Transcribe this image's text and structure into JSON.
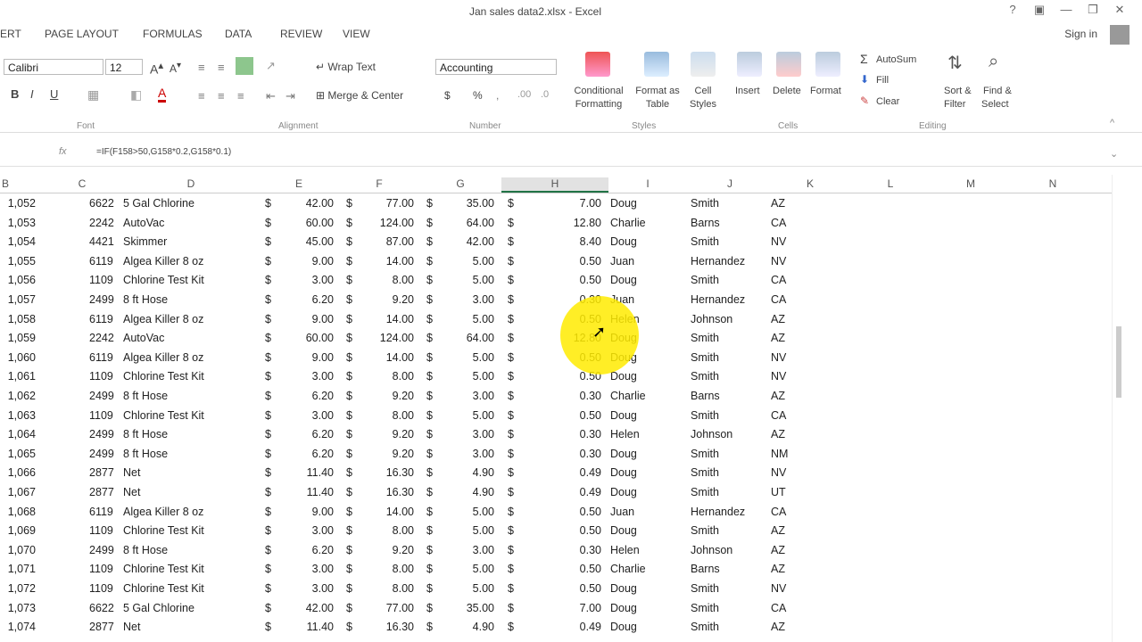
{
  "window": {
    "title": "Jan sales data2.xlsx - Excel",
    "controls": [
      "?",
      "▣",
      "—",
      "❐",
      "✕"
    ]
  },
  "tabs": [
    "ERT",
    "PAGE LAYOUT",
    "FORMULAS",
    "DATA",
    "REVIEW",
    "VIEW"
  ],
  "signin": "Sign in",
  "ribbon": {
    "font_name": "Calibri",
    "font_size": "12",
    "font_group": "Font",
    "alignment_group": "Alignment",
    "number_group": "Number",
    "styles_group": "Styles",
    "cells_group": "Cells",
    "editing_group": "Editing",
    "wrap_text": "Wrap Text",
    "merge_center": "Merge & Center",
    "number_format": "Accounting",
    "bold": "B",
    "italic": "I",
    "underline": "U",
    "currency": "$",
    "percent": "%",
    "conditional": "Conditional",
    "formatting": "Formatting",
    "format_as": "Format as",
    "table": "Table",
    "cell": "Cell",
    "styles": "Styles",
    "insert": "Insert",
    "delete": "Delete",
    "format": "Format",
    "autosum": "AutoSum",
    "fill": "Fill",
    "clear": "Clear",
    "sort": "Sort &",
    "filter": "Filter",
    "find": "Find &",
    "select": "Select"
  },
  "formula": "=IF(F158>50,G158*0.2,G158*0.1)",
  "columns": [
    "B",
    "C",
    "D",
    "E",
    "F",
    "G",
    "H",
    "I",
    "J",
    "K",
    "L",
    "M",
    "N"
  ],
  "rows": [
    [
      "1,052",
      "6622",
      "5 Gal Chlorine",
      "42.00",
      "77.00",
      "35.00",
      "7.00",
      "Doug",
      "Smith",
      "AZ"
    ],
    [
      "1,053",
      "2242",
      "AutoVac",
      "60.00",
      "124.00",
      "64.00",
      "12.80",
      "Charlie",
      "Barns",
      "CA"
    ],
    [
      "1,054",
      "4421",
      "Skimmer",
      "45.00",
      "87.00",
      "42.00",
      "8.40",
      "Doug",
      "Smith",
      "NV"
    ],
    [
      "1,055",
      "6119",
      "Algea Killer 8 oz",
      "9.00",
      "14.00",
      "5.00",
      "0.50",
      "Juan",
      "Hernandez",
      "NV"
    ],
    [
      "1,056",
      "1109",
      "Chlorine Test Kit",
      "3.00",
      "8.00",
      "5.00",
      "0.50",
      "Doug",
      "Smith",
      "CA"
    ],
    [
      "1,057",
      "2499",
      "8 ft Hose",
      "6.20",
      "9.20",
      "3.00",
      "0.30",
      "Juan",
      "Hernandez",
      "CA"
    ],
    [
      "1,058",
      "6119",
      "Algea Killer 8 oz",
      "9.00",
      "14.00",
      "5.00",
      "0.50",
      "Helen",
      "Johnson",
      "AZ"
    ],
    [
      "1,059",
      "2242",
      "AutoVac",
      "60.00",
      "124.00",
      "64.00",
      "12.80",
      "Doug",
      "Smith",
      "AZ"
    ],
    [
      "1,060",
      "6119",
      "Algea Killer 8 oz",
      "9.00",
      "14.00",
      "5.00",
      "0.50",
      "Doug",
      "Smith",
      "NV"
    ],
    [
      "1,061",
      "1109",
      "Chlorine Test Kit",
      "3.00",
      "8.00",
      "5.00",
      "0.50",
      "Doug",
      "Smith",
      "NV"
    ],
    [
      "1,062",
      "2499",
      "8 ft Hose",
      "6.20",
      "9.20",
      "3.00",
      "0.30",
      "Charlie",
      "Barns",
      "AZ"
    ],
    [
      "1,063",
      "1109",
      "Chlorine Test Kit",
      "3.00",
      "8.00",
      "5.00",
      "0.50",
      "Doug",
      "Smith",
      "CA"
    ],
    [
      "1,064",
      "2499",
      "8 ft Hose",
      "6.20",
      "9.20",
      "3.00",
      "0.30",
      "Helen",
      "Johnson",
      "AZ"
    ],
    [
      "1,065",
      "2499",
      "8 ft Hose",
      "6.20",
      "9.20",
      "3.00",
      "0.30",
      "Doug",
      "Smith",
      "NM"
    ],
    [
      "1,066",
      "2877",
      "Net",
      "11.40",
      "16.30",
      "4.90",
      "0.49",
      "Doug",
      "Smith",
      "NV"
    ],
    [
      "1,067",
      "2877",
      "Net",
      "11.40",
      "16.30",
      "4.90",
      "0.49",
      "Doug",
      "Smith",
      "UT"
    ],
    [
      "1,068",
      "6119",
      "Algea Killer 8 oz",
      "9.00",
      "14.00",
      "5.00",
      "0.50",
      "Juan",
      "Hernandez",
      "CA"
    ],
    [
      "1,069",
      "1109",
      "Chlorine Test Kit",
      "3.00",
      "8.00",
      "5.00",
      "0.50",
      "Doug",
      "Smith",
      "AZ"
    ],
    [
      "1,070",
      "2499",
      "8 ft Hose",
      "6.20",
      "9.20",
      "3.00",
      "0.30",
      "Helen",
      "Johnson",
      "AZ"
    ],
    [
      "1,071",
      "1109",
      "Chlorine Test Kit",
      "3.00",
      "8.00",
      "5.00",
      "0.50",
      "Charlie",
      "Barns",
      "AZ"
    ],
    [
      "1,072",
      "1109",
      "Chlorine Test Kit",
      "3.00",
      "8.00",
      "5.00",
      "0.50",
      "Doug",
      "Smith",
      "NV"
    ],
    [
      "1,073",
      "6622",
      "5 Gal Chlorine",
      "42.00",
      "77.00",
      "35.00",
      "7.00",
      "Doug",
      "Smith",
      "CA"
    ],
    [
      "1,074",
      "2877",
      "Net",
      "11.40",
      "16.30",
      "4.90",
      "0.49",
      "Doug",
      "Smith",
      "AZ"
    ]
  ],
  "currency_symbol": "$",
  "accent": "#217346",
  "cursor_highlight": "#ffeb00"
}
